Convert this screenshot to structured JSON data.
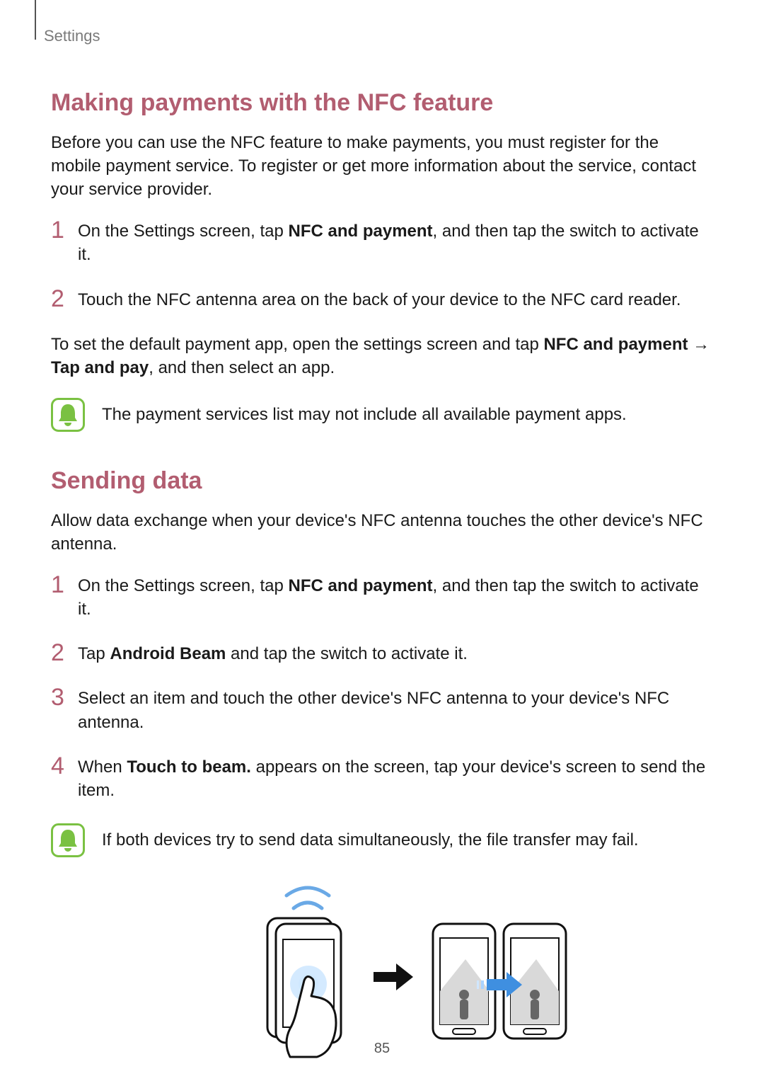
{
  "breadcrumb": "Settings",
  "section1": {
    "title": "Making payments with the NFC feature",
    "intro": "Before you can use the NFC feature to make payments, you must register for the mobile payment service. To register or get more information about the service, contact your service provider.",
    "step1_pre": "On the Settings screen, tap ",
    "step1_bold": "NFC and payment",
    "step1_post": ", and then tap the switch to activate it.",
    "step2": "Touch the NFC antenna area on the back of your device to the NFC card reader.",
    "extra_pre": "To set the default payment app, open the settings screen and tap ",
    "extra_b1": "NFC and payment",
    "extra_mid": " → ",
    "extra_b2": "Tap and pay",
    "extra_post": ", and then select an app.",
    "note": "The payment services list may not include all available payment apps."
  },
  "section2": {
    "title": "Sending data",
    "intro": "Allow data exchange when your device's NFC antenna touches the other device's NFC antenna.",
    "step1_pre": "On the Settings screen, tap ",
    "step1_bold": "NFC and payment",
    "step1_post": ", and then tap the switch to activate it.",
    "step2_pre": "Tap ",
    "step2_bold": "Android Beam",
    "step2_post": " and tap the switch to activate it.",
    "step3": "Select an item and touch the other device's NFC antenna to your device's NFC antenna.",
    "step4_pre": "When ",
    "step4_bold": "Touch to beam.",
    "step4_post": " appears on the screen, tap your device's screen to send the item.",
    "note": "If both devices try to send data simultaneously, the file transfer may fail."
  },
  "nums": {
    "n1": "1",
    "n2": "2",
    "n3": "3",
    "n4": "4"
  },
  "page_number": "85"
}
